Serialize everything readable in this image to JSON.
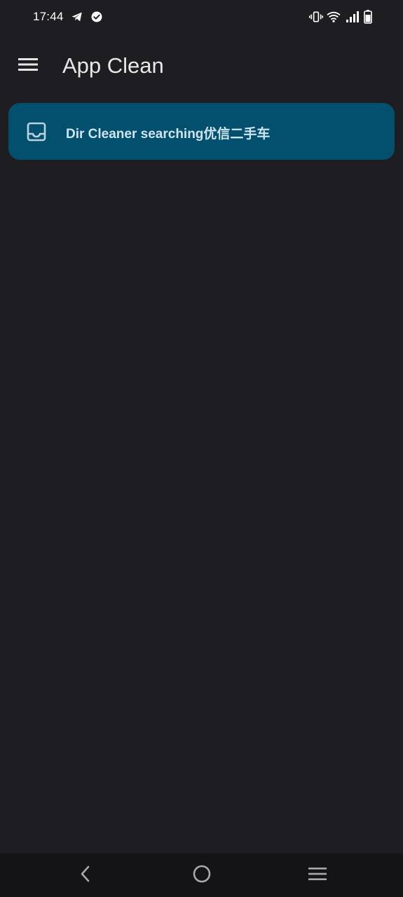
{
  "status_bar": {
    "time": "17:44",
    "left_icons": [
      "telegram-icon",
      "verified-check-icon"
    ],
    "right_icons": [
      "vibrate-icon",
      "wifi-icon",
      "signal-icon",
      "battery-icon"
    ]
  },
  "app_bar": {
    "title": "App Clean",
    "menu_icon": "hamburger-menu-icon"
  },
  "list": {
    "items": [
      {
        "icon": "inbox-tray-icon",
        "label": "Dir Cleaner searching优信二手车"
      }
    ]
  },
  "nav_bar": {
    "buttons": [
      "back-icon",
      "home-icon",
      "recents-menu-icon"
    ]
  },
  "colors": {
    "background": "#1e1d22",
    "card": "#02506e",
    "card_text": "#cfe4ef",
    "nav_bar": "#141416"
  }
}
